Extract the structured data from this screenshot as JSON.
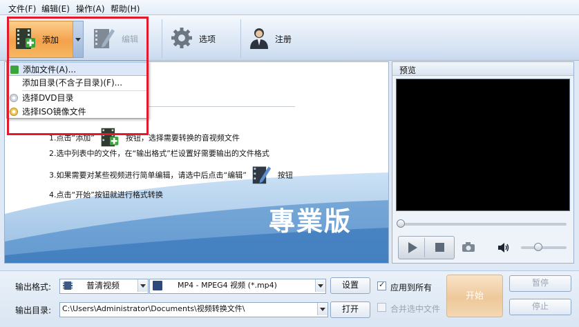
{
  "menubar": {
    "items": [
      "文件(F)",
      "编辑(E)",
      "操作(A)",
      "帮助(H)"
    ]
  },
  "toolbar": {
    "add_label": "添加",
    "edit_label": "编辑",
    "options_label": "选项",
    "register_label": "注册"
  },
  "add_menu": {
    "items": [
      "添加文件(A)...",
      "添加目录(不含子目录)(F)...",
      "选择DVD目录",
      "选择ISO镜像文件"
    ]
  },
  "instructions": {
    "step1_prefix": "1.点击“添加”",
    "step1_suffix": "按钮，选择需要转换的音视频文件",
    "step2": "2.选中列表中的文件，在“输出格式”栏设置好需要输出的文件格式",
    "step3": "3.如果需要对某些视频进行简单编辑，请选中后点击“编辑”",
    "step3_suffix": "按钮",
    "step4": "4.点击“开始”按钮就进行格式转换"
  },
  "watermark": {
    "text": "專業版"
  },
  "preview": {
    "title": "预览"
  },
  "output": {
    "format_label": "输出格式:",
    "category_value": "普清视频",
    "format_value": "MP4 - MPEG4 视频 (*.mp4)",
    "settings_button": "设置",
    "dir_label": "输出目录:",
    "dir_value": "C:\\Users\\Administrator\\Documents\\视频转换文件\\",
    "open_button": "打开",
    "apply_all_label": "应用到所有",
    "merge_label": "合并选中文件",
    "start_button": "开始",
    "pause_button": "暂停",
    "stop_button": "停止"
  },
  "colors": {
    "highlight_red": "#e3182b",
    "add_button_orange": "#f4a14a",
    "window_blue": "#dfe9f5"
  }
}
